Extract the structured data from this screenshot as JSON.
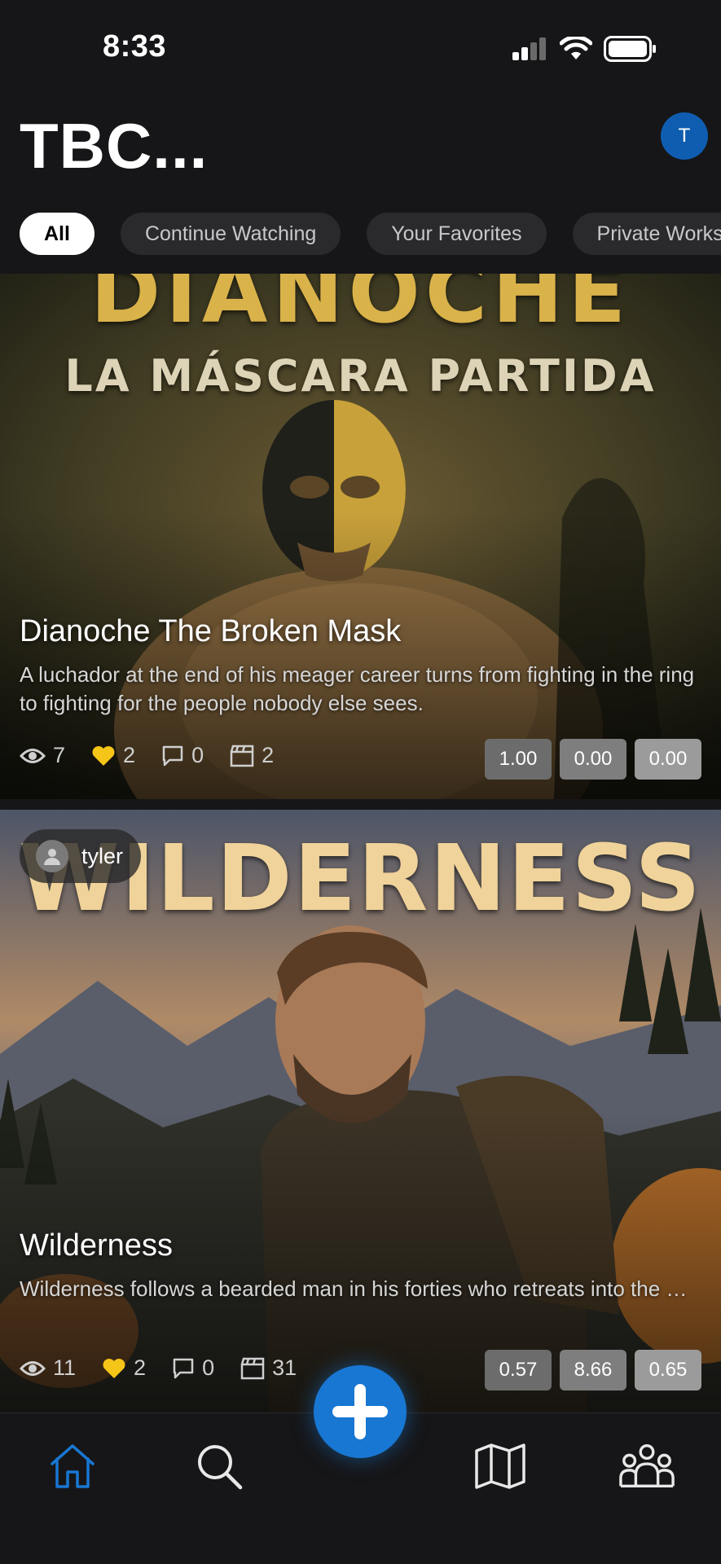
{
  "status_bar": {
    "time": "8:33"
  },
  "header": {
    "title": "TBC...",
    "avatar_initial": "T"
  },
  "filters": {
    "tabs": [
      {
        "label": "All"
      },
      {
        "label": "Continue Watching"
      },
      {
        "label": "Your Favorites"
      },
      {
        "label": "Private Works"
      }
    ]
  },
  "cards": [
    {
      "poster_title": "DIANOCHE",
      "poster_subtitle": "LA MÁSCARA PARTIDA",
      "title": "Dianoche The Broken Mask",
      "description": "A luchador at the end of his meager career turns from fighting in the ring to fighting for the people nobody else sees.",
      "views": "7",
      "likes": "2",
      "comments": "0",
      "episodes": "2",
      "scores": [
        "1.00",
        "0.00",
        "0.00"
      ]
    },
    {
      "author": "tyler",
      "poster_title": "WILDERNESS",
      "title": "Wilderness",
      "description": "Wilderness follows a bearded man in his forties who retreats into the wild on a solitary camping trip, searching for answers...",
      "views": "11",
      "likes": "2",
      "comments": "0",
      "episodes": "31",
      "scores": [
        "0.57",
        "8.66",
        "0.65"
      ]
    }
  ],
  "colors": {
    "background": "#161618",
    "accent": "#1877d2",
    "like": "#f5c518",
    "avatar": "#0f5db0"
  },
  "nav": {
    "items": [
      "home-icon",
      "search-icon",
      "add-icon",
      "map-icon",
      "community-icon"
    ],
    "active": "home-icon"
  }
}
